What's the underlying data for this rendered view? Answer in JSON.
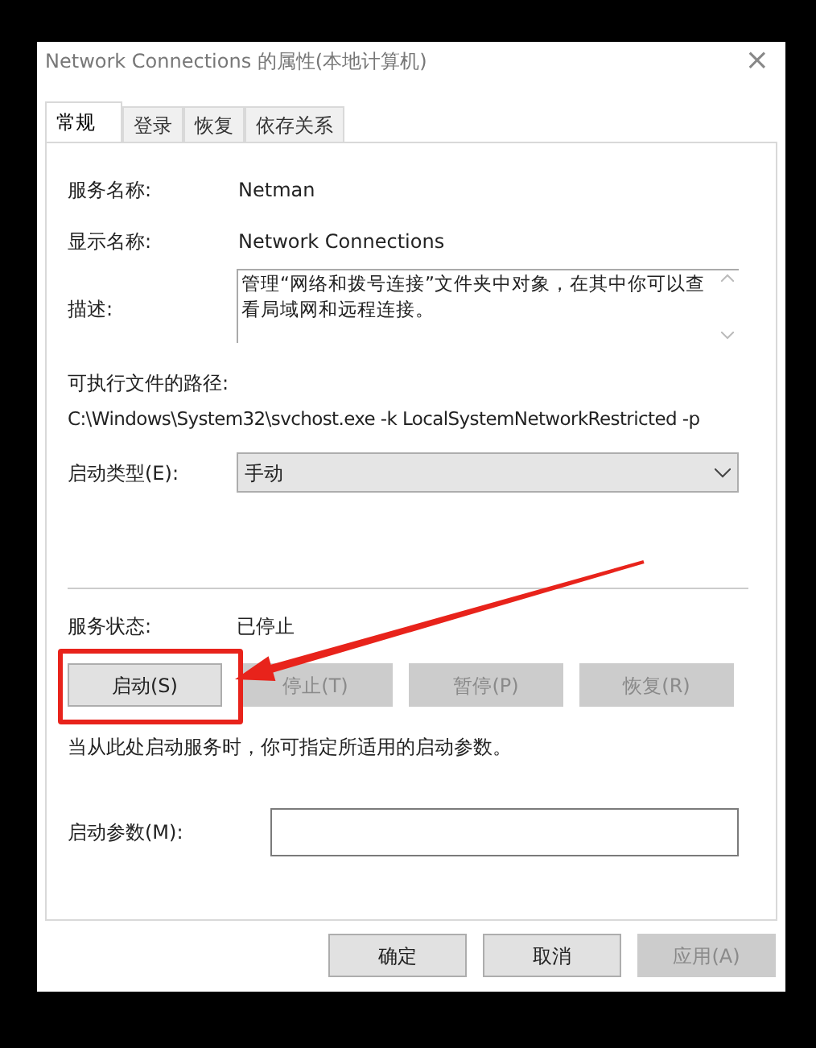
{
  "window": {
    "title": "Network Connections 的属性(本地计算机)",
    "close": "×"
  },
  "tabs": [
    {
      "label": "常规",
      "selected": true
    },
    {
      "label": "登录",
      "selected": false
    },
    {
      "label": "恢复",
      "selected": false
    },
    {
      "label": "依存关系",
      "selected": false
    }
  ],
  "service_name": {
    "label": "服务名称:",
    "value": "Netman"
  },
  "display_name": {
    "label": "显示名称:",
    "value": "Network Connections"
  },
  "description": {
    "label": "描述:",
    "value": "管理“网络和拨号连接”文件夹中对象，在其中你可以查看局域网和远程连接。"
  },
  "executable_path": {
    "label": "可执行文件的路径:",
    "value": "C:\\Windows\\System32\\svchost.exe -k LocalSystemNetworkRestricted -p"
  },
  "startup_type": {
    "label": "启动类型(E):",
    "value": "手动"
  },
  "service_status": {
    "label": "服务状态:",
    "value": "已停止"
  },
  "service_buttons": [
    {
      "label": "启动(S)",
      "disabled": false,
      "highlighted": true
    },
    {
      "label": "停止(T)",
      "disabled": true,
      "highlighted": false
    },
    {
      "label": "暂停(P)",
      "disabled": true,
      "highlighted": false
    },
    {
      "label": "恢复(R)",
      "disabled": true,
      "highlighted": false
    }
  ],
  "hint": "当从此处启动服务时，你可指定所适用的启动参数。",
  "start_parameters": {
    "label": "启动参数(M):"
  },
  "footer_buttons": [
    {
      "label": "确定",
      "disabled": false
    },
    {
      "label": "取消",
      "disabled": false
    },
    {
      "label": "应用(A)",
      "disabled": true
    }
  ]
}
